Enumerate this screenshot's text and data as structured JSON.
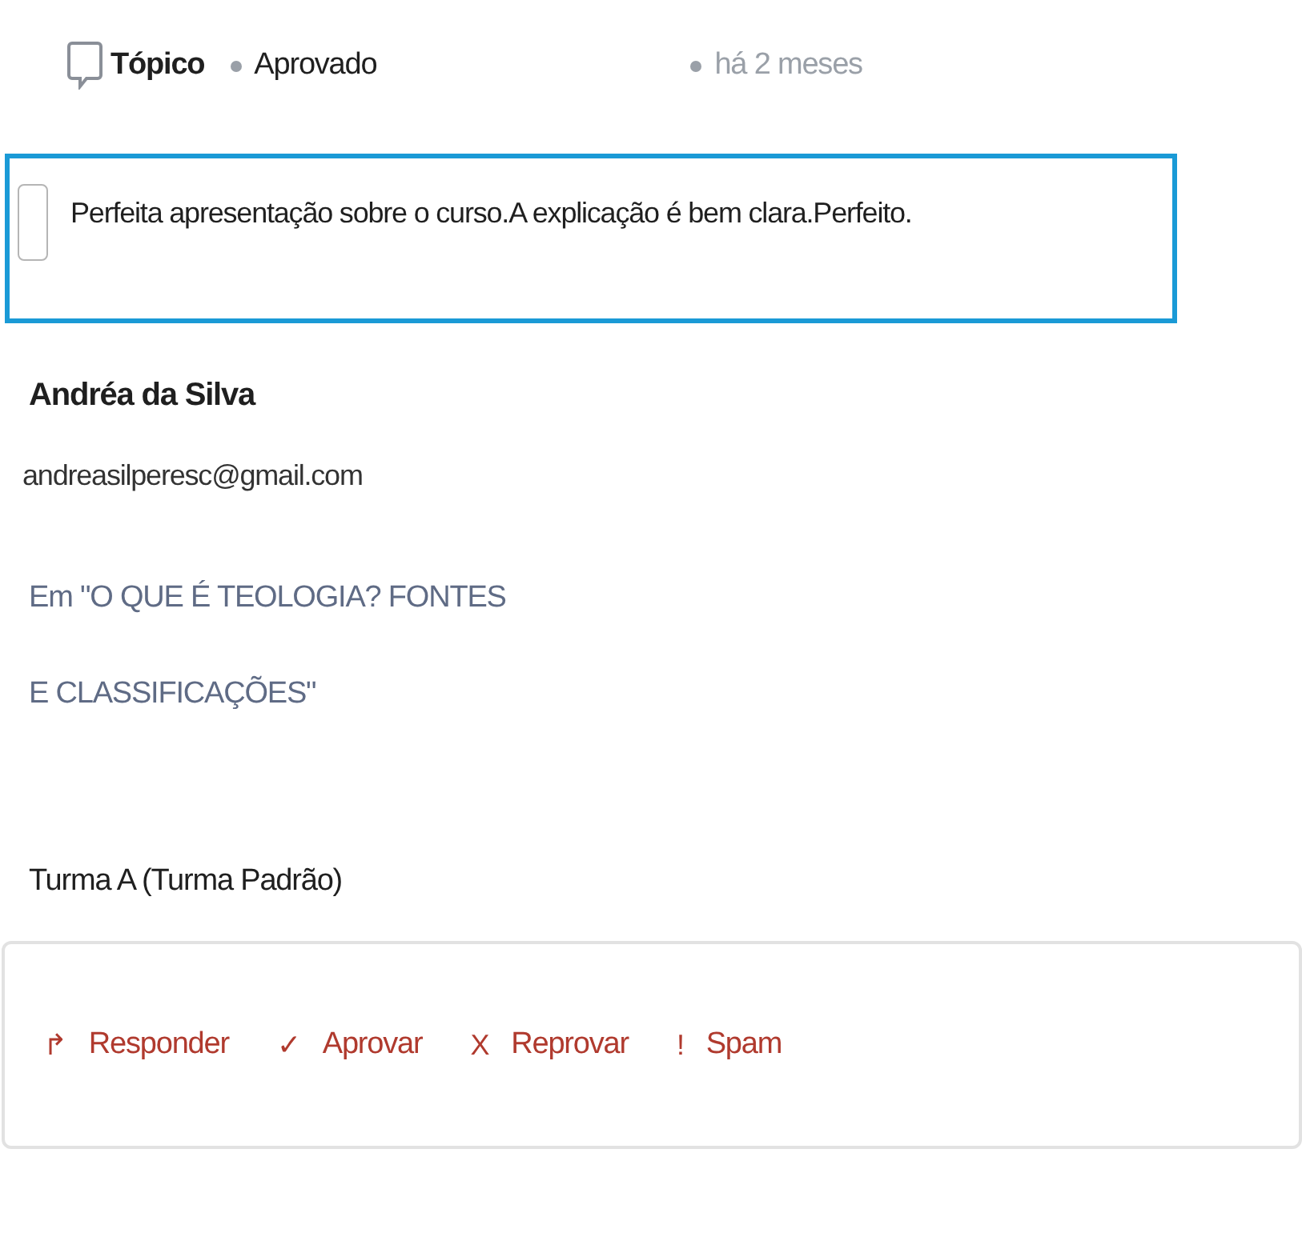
{
  "header": {
    "type_label": "Tópico",
    "status": "Aprovado",
    "time": "há 2 meses"
  },
  "comment": {
    "checked": false,
    "text": "Perfeita apresentação sobre o curso.A explicação é bem clara.Perfeito."
  },
  "author": {
    "name": "Andréa da Silva",
    "email": "andreasilperesc@gmail.com"
  },
  "course": "Em \"O QUE É TEOLOGIA? FONTES E CLASSIFICAÇÕES\"",
  "class_name": "Turma A (Turma Padrão)",
  "actions": [
    {
      "icon": "↱",
      "label": "Responder"
    },
    {
      "icon": "✓",
      "label": "Aprovar"
    },
    {
      "icon": "X",
      "label": "Reprovar"
    },
    {
      "icon": "!",
      "label": "Spam"
    }
  ]
}
